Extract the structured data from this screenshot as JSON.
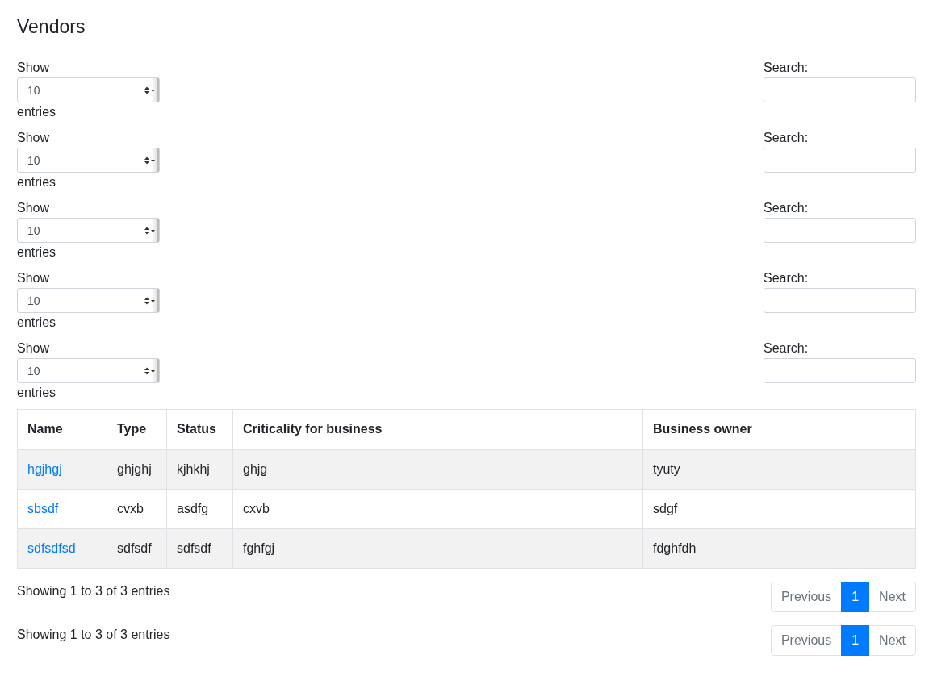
{
  "title": "Vendors",
  "controls": [
    {
      "show_label": "Show",
      "length_value": "10",
      "entries_label": "entries",
      "search_label": "Search:"
    },
    {
      "show_label": "Show",
      "length_value": "10",
      "entries_label": "entries",
      "search_label": "Search:"
    },
    {
      "show_label": "Show",
      "length_value": "10",
      "entries_label": "entries",
      "search_label": "Search:"
    },
    {
      "show_label": "Show",
      "length_value": "10",
      "entries_label": "entries",
      "search_label": "Search:"
    },
    {
      "show_label": "Show",
      "length_value": "10",
      "entries_label": "entries",
      "search_label": "Search:"
    }
  ],
  "table": {
    "columns": [
      "Name",
      "Type",
      "Status",
      "Criticality for business",
      "Business owner"
    ],
    "rows": [
      {
        "cells": [
          "hgjhgj",
          "ghjghj",
          "kjhkhj",
          "ghjg",
          "tyuty"
        ]
      },
      {
        "cells": [
          "sbsdf",
          "cvxb",
          "asdfg",
          "cxvb",
          "sdgf"
        ]
      },
      {
        "cells": [
          "sdfsdfsd",
          "sdfsdf",
          "sdfsdf",
          "fghfgj",
          "fdghfdh"
        ]
      }
    ]
  },
  "footers": [
    {
      "info": "Showing 1 to 3 of 3 entries",
      "pages": [
        {
          "label": "Previous",
          "selected": false
        },
        {
          "label": "1",
          "selected": true
        },
        {
          "label": "Next",
          "selected": false
        }
      ]
    },
    {
      "info": "Showing 1 to 3 of 3 entries",
      "pages": [
        {
          "label": "Previous",
          "selected": false
        },
        {
          "label": "1",
          "selected": true
        },
        {
          "label": "Next",
          "selected": false
        }
      ]
    }
  ]
}
